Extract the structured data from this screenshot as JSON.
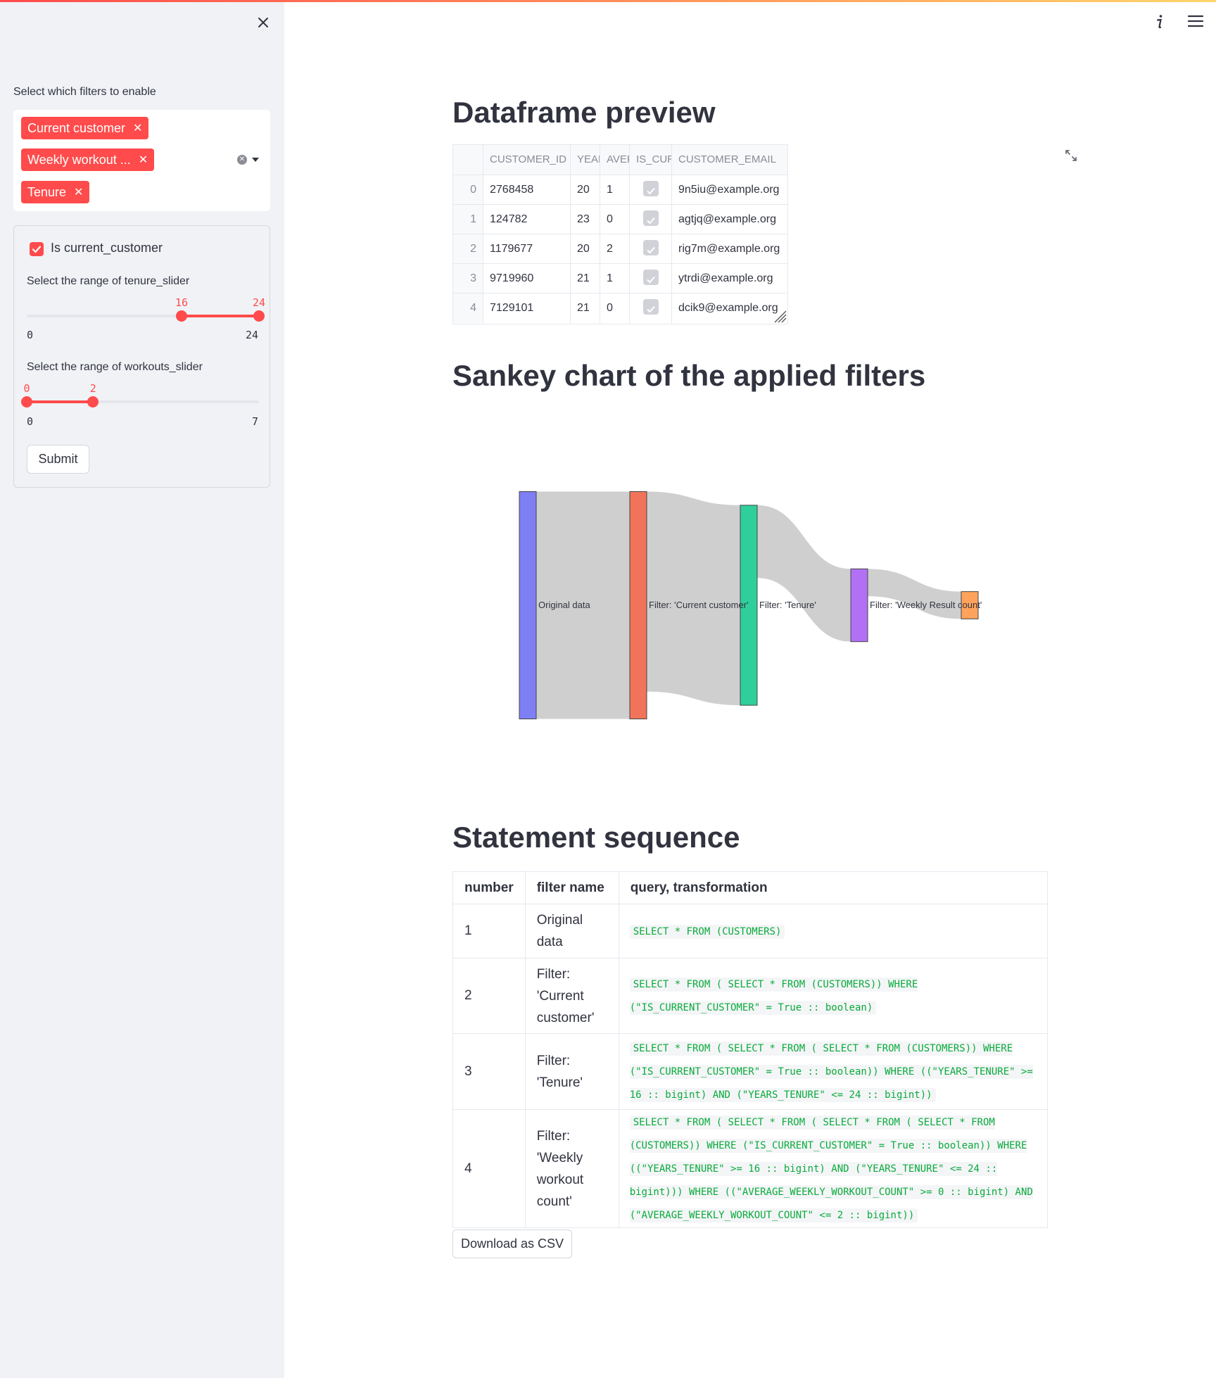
{
  "sidebar": {
    "filters_label": "Select which filters to enable",
    "selected_filters": [
      "Current customer",
      "Weekly workout ...",
      "Tenure"
    ],
    "form": {
      "checkbox_label": "Is current_customer",
      "checkbox_checked": true,
      "tenure_slider": {
        "label": "Select the range of tenure_slider",
        "min": "0",
        "max": "24",
        "low": "16",
        "high": "24",
        "range": [
          0,
          24
        ],
        "value": [
          16,
          24
        ]
      },
      "workouts_slider": {
        "label": "Select the range of workouts_slider",
        "min": "0",
        "max": "7",
        "low": "0",
        "high": "2",
        "range": [
          0,
          7
        ],
        "value": [
          0,
          2
        ]
      },
      "submit_label": "Submit"
    }
  },
  "main": {
    "preview_title": "Dataframe preview",
    "dataframe": {
      "columns": [
        "",
        "CUSTOMER_ID",
        "YEAR",
        "AVEF",
        "IS_CUR",
        "CUSTOMER_EMAIL"
      ],
      "rows": [
        {
          "index": "0",
          "customer_id": "2768458",
          "years": "20",
          "avg": "1",
          "is_current": true,
          "email": "9n5iu@example.org"
        },
        {
          "index": "1",
          "customer_id": "124782",
          "years": "23",
          "avg": "0",
          "is_current": true,
          "email": "agtjq@example.org"
        },
        {
          "index": "2",
          "customer_id": "1179677",
          "years": "20",
          "avg": "2",
          "is_current": true,
          "email": "rig7m@example.org"
        },
        {
          "index": "3",
          "customer_id": "9719960",
          "years": "21",
          "avg": "1",
          "is_current": true,
          "email": "ytrdi@example.org"
        },
        {
          "index": "4",
          "customer_id": "7129101",
          "years": "21",
          "avg": "0",
          "is_current": true,
          "email": "dcik9@example.org"
        }
      ]
    },
    "sankey_title": "Sankey chart of the applied filters",
    "sequence_title": "Statement sequence",
    "sequence_table": {
      "headers": [
        "number",
        "filter name",
        "query, transformation"
      ],
      "rows": [
        {
          "number": "1",
          "filter_name": "Original data",
          "query": "SELECT * FROM (CUSTOMERS)"
        },
        {
          "number": "2",
          "filter_name": "Filter: 'Current customer'",
          "query": "SELECT * FROM ( SELECT * FROM (CUSTOMERS)) WHERE (\"IS_CURRENT_CUSTOMER\" = True :: boolean)"
        },
        {
          "number": "3",
          "filter_name": "Filter: 'Tenure'",
          "query": "SELECT * FROM ( SELECT * FROM ( SELECT * FROM (CUSTOMERS)) WHERE (\"IS_CURRENT_CUSTOMER\" = True :: boolean)) WHERE ((\"YEARS_TENURE\" >= 16 :: bigint) AND (\"YEARS_TENURE\" <= 24 :: bigint))"
        },
        {
          "number": "4",
          "filter_name": "Filter: 'Weekly workout count'",
          "query": "SELECT * FROM ( SELECT * FROM ( SELECT * FROM ( SELECT * FROM (CUSTOMERS)) WHERE (\"IS_CURRENT_CUSTOMER\" = True :: boolean)) WHERE ((\"YEARS_TENURE\" >= 16 :: bigint) AND (\"YEARS_TENURE\" <= 24 :: bigint))) WHERE ((\"AVERAGE_WEEKLY_WORKOUT_COUNT\" >= 0 :: bigint) AND (\"AVERAGE_WEEKLY_WORKOUT_COUNT\" <= 2 :: bigint))"
        }
      ]
    },
    "download_label": "Download as CSV"
  },
  "colors": {
    "accent": "#ff4b4b",
    "sidebar_bg": "#f0f2f6",
    "code_green": "#09ab3b",
    "node_colors": [
      "#7f7ff5",
      "#f1735a",
      "#2fcf9b",
      "#b270f5",
      "#ffa35c"
    ],
    "link_color": "#cccccc"
  },
  "icons": {
    "close": "close-icon",
    "info": "info-icon",
    "menu": "hamburger-menu-icon",
    "expand": "expand-icon",
    "clear": "clear-icon",
    "dropdown": "chevron-down-icon",
    "check": "check-icon"
  },
  "chart_data": {
    "type": "sankey",
    "title": "",
    "nodes": [
      {
        "label": "Original data",
        "value": 100
      },
      {
        "label": "Filter: 'Current customer'",
        "value": 100
      },
      {
        "label": "Filter: 'Tenure'",
        "value": 88
      },
      {
        "label": "Filter: 'Weekly Result count'",
        "value": 32
      },
      {
        "label": "",
        "value": 12
      }
    ],
    "links": [
      {
        "source": 0,
        "target": 1,
        "value": 100
      },
      {
        "source": 1,
        "target": 2,
        "value": 88
      },
      {
        "source": 2,
        "target": 3,
        "value": 32
      },
      {
        "source": 3,
        "target": 4,
        "value": 12
      }
    ]
  }
}
